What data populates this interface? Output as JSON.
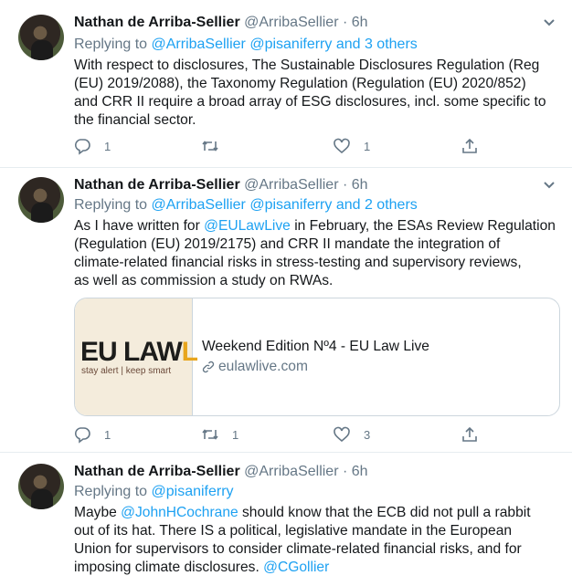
{
  "tweets": [
    {
      "name": "Nathan de Arriba-Sellier",
      "handle": "@ArribaSellier",
      "dot": "·",
      "time": "6h",
      "replying_prefix": "Replying to",
      "replying_to": "@ArribaSellier @pisaniferry and 3 others",
      "text_lines": [
        "With respect to disclosures, The Sustainable Disclosures Regulation (Reg",
        "(EU) 2019/2088), the Taxonomy Regulation (Regulation (EU) 2020/852)",
        "and CRR II require a broad array of ESG disclosures, incl. some specific to",
        "the financial sector."
      ],
      "reply_count": "1",
      "retweet_count": "",
      "like_count": "1"
    },
    {
      "name": "Nathan de Arriba-Sellier",
      "handle": "@ArribaSellier",
      "dot": "·",
      "time": "6h",
      "replying_prefix": "Replying to",
      "replying_to": "@ArribaSellier @pisaniferry and 2 others",
      "text_line1_prefix": "As I have written for ",
      "text_line1_mention": "@EULawLive",
      "text_line1_suffix": " in February, the ESAs Review Regulation",
      "text_lines": [
        "(Regulation (EU) 2019/2175) and CRR II mandate the integration of",
        "climate-related financial risks in stress-testing and supervisory reviews,",
        "as well as commission a study on RWAs."
      ],
      "card": {
        "logo_text": "EU LAW",
        "logo_tail": "L",
        "logo_tagline": "stay alert | keep smart",
        "title": "Weekend Edition Nº4 - EU Law Live",
        "domain": "eulawlive.com"
      },
      "reply_count": "1",
      "retweet_count": "1",
      "like_count": "3"
    },
    {
      "name": "Nathan de Arriba-Sellier",
      "handle": "@ArribaSellier",
      "dot": "·",
      "time": "6h",
      "replying_prefix": "Replying to",
      "replying_to": "@pisaniferry",
      "line1_prefix": "Maybe ",
      "line1_mention": "@JohnHCochrane",
      "line1_suffix": " should know that the ECB did not pull a rabbit",
      "text_lines": [
        "out of its hat. There IS a political, legislative mandate in the European",
        "Union for supervisors to consider climate-related financial risks, and for"
      ],
      "line4_prefix": "imposing climate disclosures. ",
      "line4_mention": "@CGollier"
    }
  ],
  "colors": {
    "link": "#1da1f2",
    "muted": "#657786",
    "divider": "#e6ecf0"
  },
  "icons": [
    "reply-icon",
    "retweet-icon",
    "like-icon",
    "share-icon",
    "chevron-down-icon",
    "link-icon"
  ]
}
